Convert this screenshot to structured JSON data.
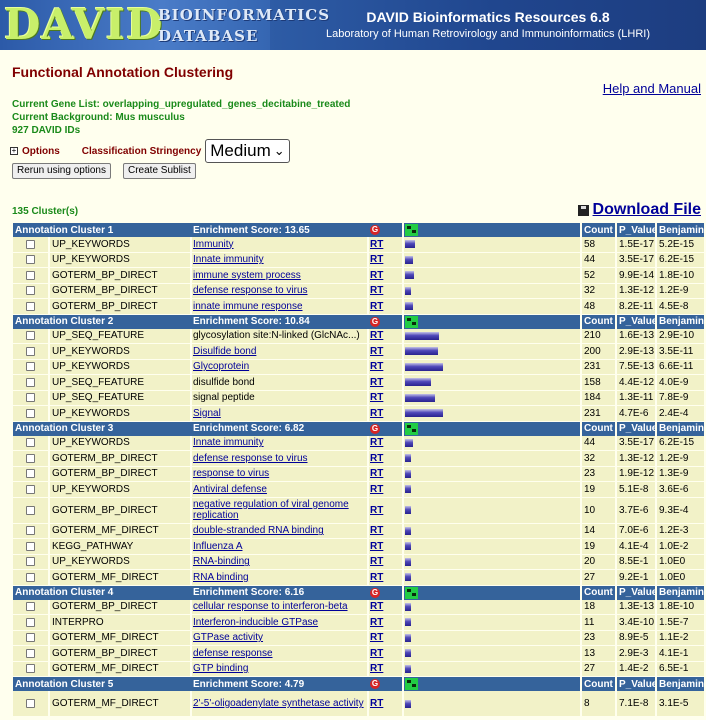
{
  "header": {
    "logo_main": "DAVID",
    "logo_sub1": "BIOINFORMATICS",
    "logo_sub2": "DATABASE",
    "title": "DAVID Bioinformatics Resources 6.8",
    "subtitle": "Laboratory of Human Retrovirology and Immunoinformatics (LHRI)"
  },
  "page_title": "Functional Annotation Clustering",
  "help_link": "Help and Manual",
  "gene_list": "Current Gene List: overlapping_upregulated_genes_decitabine_treated",
  "background": "Current Background: Mus musculus",
  "id_count": "927 DAVID IDs",
  "options": {
    "plus": "+",
    "options_label": "Options",
    "stringency_label": "Classification Stringency",
    "stringency_value": "Medium",
    "chevron": "⌄",
    "rerun_button": "Rerun using options",
    "sublist_button": "Create Sublist"
  },
  "clusters_count": "135 Cluster(s)",
  "download_label": "Download File",
  "table_labels": {
    "g_icon": "G",
    "rt": "RT",
    "count": "Count",
    "p_value": "P_Value",
    "benjamini": "Benjamini"
  },
  "clusters": [
    {
      "title": "Annotation Cluster 1",
      "score": "Enrichment Score: 13.65",
      "rows": [
        {
          "cat": "UP_KEYWORDS",
          "term": "Immunity",
          "link": true,
          "count": "58",
          "p": "1.5E-17",
          "b": "5.2E-15",
          "bar": 0.25
        },
        {
          "cat": "UP_KEYWORDS",
          "term": "Innate immunity",
          "link": true,
          "count": "44",
          "p": "3.5E-17",
          "b": "6.2E-15",
          "bar": 0.2
        },
        {
          "cat": "GOTERM_BP_DIRECT",
          "term": "immune system process",
          "link": true,
          "count": "52",
          "p": "9.9E-14",
          "b": "1.8E-10",
          "bar": 0.23
        },
        {
          "cat": "GOTERM_BP_DIRECT",
          "term": "defense response to virus",
          "link": true,
          "count": "32",
          "p": "1.3E-12",
          "b": "1.2E-9",
          "bar": 0.15
        },
        {
          "cat": "GOTERM_BP_DIRECT",
          "term": "innate immune response",
          "link": true,
          "count": "48",
          "p": "8.2E-11",
          "b": "4.5E-8",
          "bar": 0.21
        }
      ]
    },
    {
      "title": "Annotation Cluster 2",
      "score": "Enrichment Score: 10.84",
      "rows": [
        {
          "cat": "UP_SEQ_FEATURE",
          "term": "glycosylation site:N-linked (GlcNAc...)",
          "link": false,
          "count": "210",
          "p": "1.6E-13",
          "b": "2.9E-10",
          "bar": 0.9
        },
        {
          "cat": "UP_KEYWORDS",
          "term": "Disulfide bond",
          "link": true,
          "count": "200",
          "p": "2.9E-13",
          "b": "3.5E-11",
          "bar": 0.86
        },
        {
          "cat": "UP_KEYWORDS",
          "term": "Glycoprotein",
          "link": true,
          "count": "231",
          "p": "7.5E-13",
          "b": "6.6E-11",
          "bar": 1.0
        },
        {
          "cat": "UP_SEQ_FEATURE",
          "term": "disulfide bond",
          "link": false,
          "count": "158",
          "p": "4.4E-12",
          "b": "4.0E-9",
          "bar": 0.68
        },
        {
          "cat": "UP_SEQ_FEATURE",
          "term": "signal peptide",
          "link": false,
          "count": "184",
          "p": "1.3E-11",
          "b": "7.8E-9",
          "bar": 0.8
        },
        {
          "cat": "UP_KEYWORDS",
          "term": "Signal",
          "link": true,
          "count": "231",
          "p": "4.7E-6",
          "b": "2.4E-4",
          "bar": 1.0
        }
      ]
    },
    {
      "title": "Annotation Cluster 3",
      "score": "Enrichment Score: 6.82",
      "rows": [
        {
          "cat": "UP_KEYWORDS",
          "term": "Innate immunity",
          "link": true,
          "count": "44",
          "p": "3.5E-17",
          "b": "6.2E-15",
          "bar": 0.2
        },
        {
          "cat": "GOTERM_BP_DIRECT",
          "term": "defense response to virus",
          "link": true,
          "count": "32",
          "p": "1.3E-12",
          "b": "1.2E-9",
          "bar": 0.15
        },
        {
          "cat": "GOTERM_BP_DIRECT",
          "term": "response to virus",
          "link": true,
          "count": "23",
          "p": "1.9E-12",
          "b": "1.3E-9",
          "bar": 0.11
        },
        {
          "cat": "UP_KEYWORDS",
          "term": "Antiviral defense",
          "link": true,
          "count": "19",
          "p": "5.1E-8",
          "b": "3.6E-6",
          "bar": 0.09
        },
        {
          "cat": "GOTERM_BP_DIRECT",
          "term": "negative regulation of viral genome replication",
          "link": true,
          "count": "10",
          "p": "3.7E-6",
          "b": "9.3E-4",
          "bar": 0.05,
          "tall": true
        },
        {
          "cat": "GOTERM_MF_DIRECT",
          "term": "double-stranded RNA binding",
          "link": true,
          "count": "14",
          "p": "7.0E-6",
          "b": "1.2E-3",
          "bar": 0.07
        },
        {
          "cat": "KEGG_PATHWAY",
          "term": "Influenza A",
          "link": true,
          "count": "19",
          "p": "4.1E-4",
          "b": "1.0E-2",
          "bar": 0.09
        },
        {
          "cat": "UP_KEYWORDS",
          "term": "RNA-binding",
          "link": true,
          "count": "20",
          "p": "8.5E-1",
          "b": "1.0E0",
          "bar": 0.09
        },
        {
          "cat": "GOTERM_MF_DIRECT",
          "term": "RNA binding",
          "link": true,
          "count": "27",
          "p": "9.2E-1",
          "b": "1.0E0",
          "bar": 0.12
        }
      ]
    },
    {
      "title": "Annotation Cluster 4",
      "score": "Enrichment Score: 6.16",
      "rows": [
        {
          "cat": "GOTERM_BP_DIRECT",
          "term": "cellular response to interferon-beta",
          "link": true,
          "count": "18",
          "p": "1.3E-13",
          "b": "1.8E-10",
          "bar": 0.09
        },
        {
          "cat": "INTERPRO",
          "term": "Interferon-inducible GTPase",
          "link": true,
          "count": "11",
          "p": "3.4E-10",
          "b": "1.5E-7",
          "bar": 0.05
        },
        {
          "cat": "GOTERM_MF_DIRECT",
          "term": "GTPase activity",
          "link": true,
          "count": "23",
          "p": "8.9E-5",
          "b": "1.1E-2",
          "bar": 0.11
        },
        {
          "cat": "GOTERM_BP_DIRECT",
          "term": "defense response",
          "link": true,
          "count": "13",
          "p": "2.9E-3",
          "b": "4.1E-1",
          "bar": 0.06
        },
        {
          "cat": "GOTERM_MF_DIRECT",
          "term": "GTP binding",
          "link": true,
          "count": "27",
          "p": "1.4E-2",
          "b": "6.5E-1",
          "bar": 0.12
        }
      ]
    },
    {
      "title": "Annotation Cluster 5",
      "score": "Enrichment Score: 4.79",
      "rows": [
        {
          "cat": "GOTERM_MF_DIRECT",
          "term": "2'-5'-oligoadenylate synthetase activity",
          "link": true,
          "count": "8",
          "p": "7.1E-8",
          "b": "3.1E-5",
          "bar": 0.04,
          "tall": true
        }
      ]
    }
  ]
}
